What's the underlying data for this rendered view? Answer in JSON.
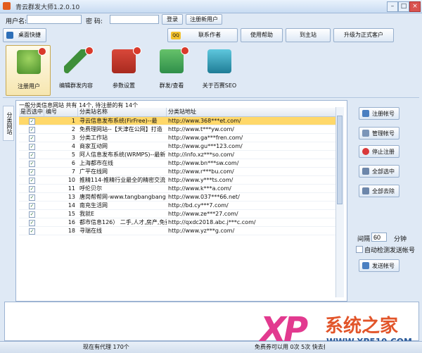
{
  "window": {
    "title": "青云群发大师1.2.0.10",
    "min": "–",
    "max": "□",
    "close": "×"
  },
  "login": {
    "username_label": "用户名:",
    "username_value": "",
    "password_label": "密  码:",
    "password_value": "",
    "login_button": "登录",
    "register_button": "注册新用户"
  },
  "toolbar": {
    "desktop_shortcut": "桌面快捷",
    "qq_contact": "联系作者",
    "help": "使用帮助",
    "website": "到主站",
    "upgrade": "升级为正式客户"
  },
  "tools": [
    {
      "label": "注册用户",
      "icon": "user-register-icon",
      "color": "#6aa33a"
    },
    {
      "label": "编辑群发内容",
      "icon": "pencil-icon",
      "color": "#3f8f3a"
    },
    {
      "label": "参数设置",
      "icon": "toolbox-icon",
      "color": "#c23b2b"
    },
    {
      "label": "群发/查看",
      "icon": "chat-bubbles-icon",
      "color": "#3aa35a"
    },
    {
      "label": "关于百赛SEO",
      "icon": "monitor-icon",
      "color": "#2c8fa8"
    }
  ],
  "side_tab": "分类网站",
  "panel": {
    "title": "一般分类信息网站 共有 14个, 待注册的有 14个",
    "columns": [
      "是否选中",
      "编号",
      "分类站名称",
      "分类站地址"
    ],
    "rows": [
      {
        "checked": true,
        "id": "1",
        "name": "寻云信息发布系统(FirFree)--最",
        "url": "http://www.368***et.com/",
        "selected": true
      },
      {
        "checked": true,
        "id": "2",
        "name": "免费理网站--【天津在公网】打造",
        "url": "http://www.t***yw.com/",
        "selected": false
      },
      {
        "checked": true,
        "id": "3",
        "name": "分类工作站",
        "url": "http://www.ga***fren.com/",
        "selected": false
      },
      {
        "checked": true,
        "id": "4",
        "name": "商家互动网",
        "url": "http://www.gu***123.com/",
        "selected": false
      },
      {
        "checked": true,
        "id": "5",
        "name": "阿人信息发布系统(WRMPS)--最新",
        "url": "http://info.xz***so.com/",
        "selected": false
      },
      {
        "checked": true,
        "id": "6",
        "name": "上海都市在线",
        "url": "http://www.bn***sw.com/",
        "selected": false
      },
      {
        "checked": true,
        "id": "7",
        "name": "广平在线网",
        "url": "http://www.r***bu.com/",
        "selected": false
      },
      {
        "checked": true,
        "id": "10",
        "name": "推精114-推精行业最全的精密交流",
        "url": "http://www.y***ts.com/",
        "selected": false
      },
      {
        "checked": true,
        "id": "11",
        "name": "呼伦贝尔",
        "url": "http://www.k***a.com/",
        "selected": false
      },
      {
        "checked": true,
        "id": "13",
        "name": "唐岗帮帮网-www.tangbangbang",
        "url": "http://www.037***66.net/",
        "selected": false
      },
      {
        "checked": true,
        "id": "14",
        "name": "南充生活网",
        "url": "http://bd.cy***7.com/",
        "selected": false
      },
      {
        "checked": true,
        "id": "15",
        "name": "我就E",
        "url": "http://www.ze***27.com/",
        "selected": false
      },
      {
        "checked": true,
        "id": "16",
        "name": "都市信息126） 二手,人才,房产,免费",
        "url": "http://qxdc2018.abc.j***c.com/",
        "selected": false
      },
      {
        "checked": true,
        "id": "18",
        "name": "寻瑞在线",
        "url": "http://www.yz***g.com/",
        "selected": false
      }
    ]
  },
  "right_panel": {
    "register_account": "注册帐号",
    "manage_account": "管理帐号",
    "stop_register": "停止注册",
    "select_all": "全部选中",
    "deselect_all": "全部去除",
    "interval_label": "间隔",
    "interval_value": "60",
    "interval_unit": "分钟",
    "auto_check_label": "自动检测发送帐号",
    "send_account": "发送帐号"
  },
  "status": {
    "left": "",
    "center": "现在有代理 170个",
    "right": "免费券可以用 0次 5次 快去推荐吧"
  },
  "watermark": {
    "xp": "XP",
    "cn": "系统之家",
    "url": "WWW.XP510.COM"
  }
}
